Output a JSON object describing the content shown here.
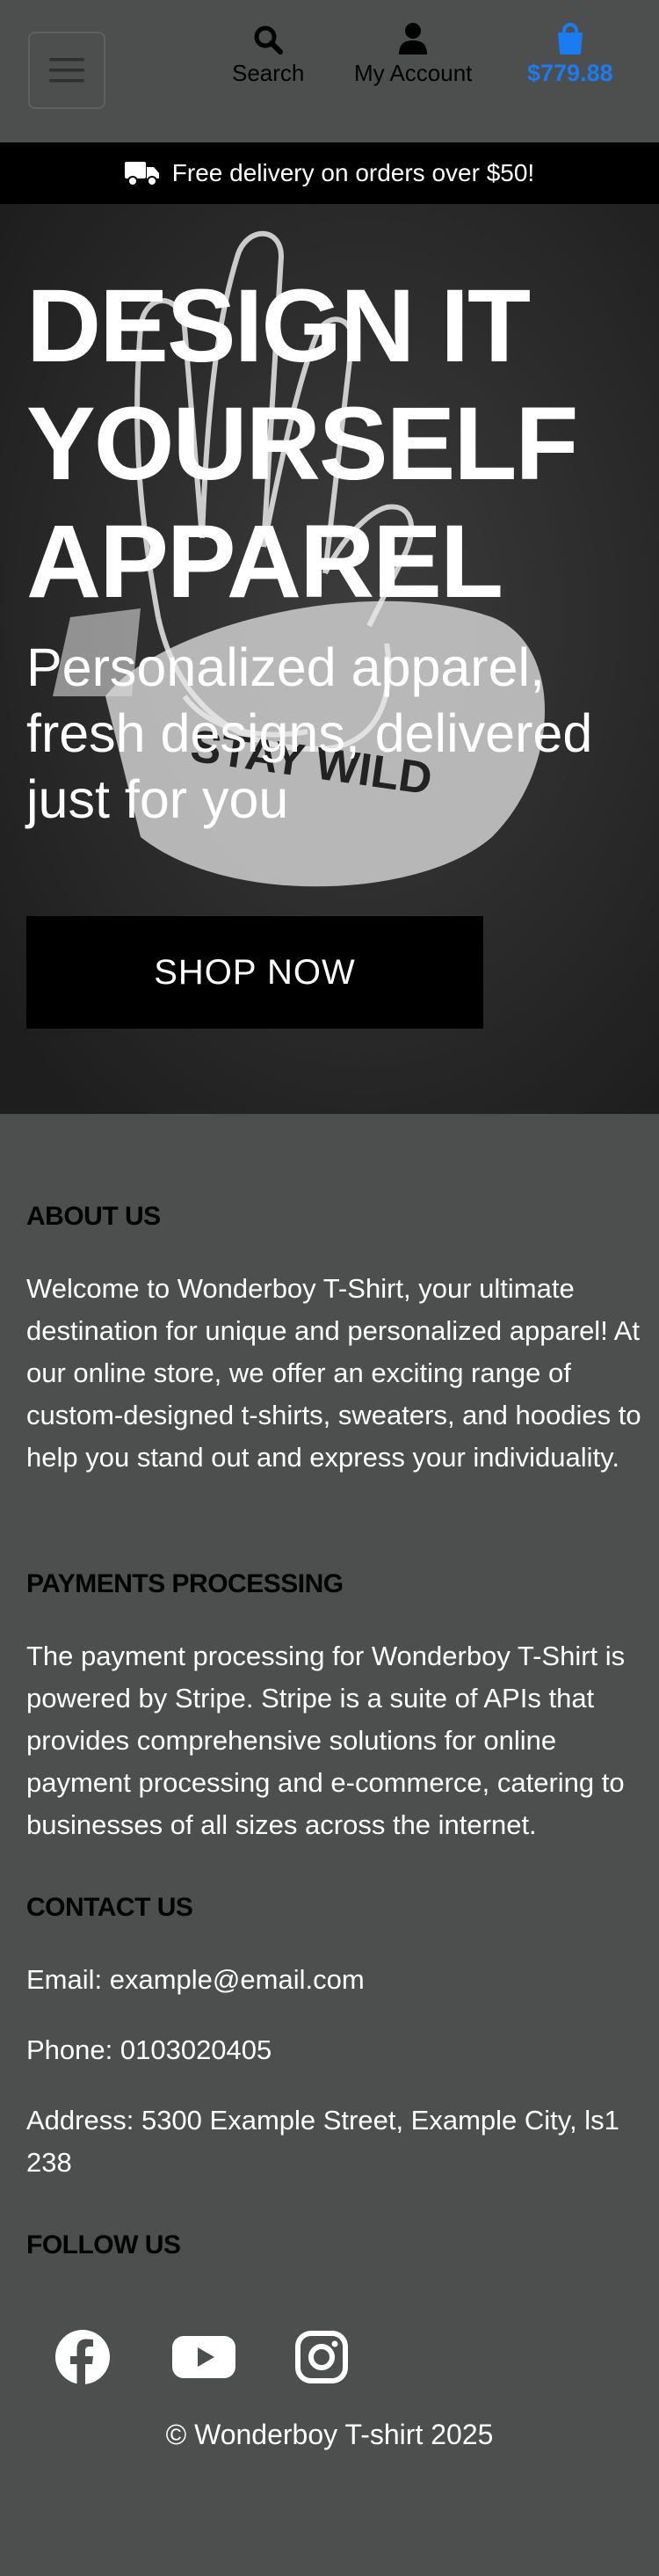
{
  "header": {
    "menu_icon": "hamburger-icon",
    "search_label": "Search",
    "account_label": "My Account",
    "cart_total": "$779.88",
    "accent_color": "#1a7cf2"
  },
  "banner": {
    "text": "Free delivery on orders over $50!",
    "icon": "truck-icon"
  },
  "hero": {
    "title": "DESIGN IT YOURSELF APPAREL",
    "subtitle": "Personalized apparel, fresh designs, delivered just for you",
    "cta": "SHOP NOW"
  },
  "footer": {
    "about_heading": "ABOUT US",
    "about_text": "Welcome to Wonderboy T-Shirt, your ultimate destination for unique and personalized apparel! At our online store, we offer an exciting range of custom-designed t-shirts, sweaters, and hoodies to help you stand out and express your individuality.",
    "payments_heading": "PAYMENTS PROCESSING",
    "payments_text": "The payment processing for Wonderboy T-Shirt is powered by Stripe. Stripe is a suite of APIs that provides comprehensive solutions for online payment processing and e-commerce, catering to businesses of all sizes across the internet.",
    "contact_heading": "CONTACT US",
    "email": "Email: example@email.com",
    "phone": "Phone: 0103020405",
    "address": "Address: 5300 Example Street, Example City, ls1 238",
    "follow_heading": "FOLLOW US",
    "social": [
      "facebook-icon",
      "youtube-icon",
      "instagram-icon"
    ],
    "copyright": "© Wonderboy T-shirt 2025"
  }
}
